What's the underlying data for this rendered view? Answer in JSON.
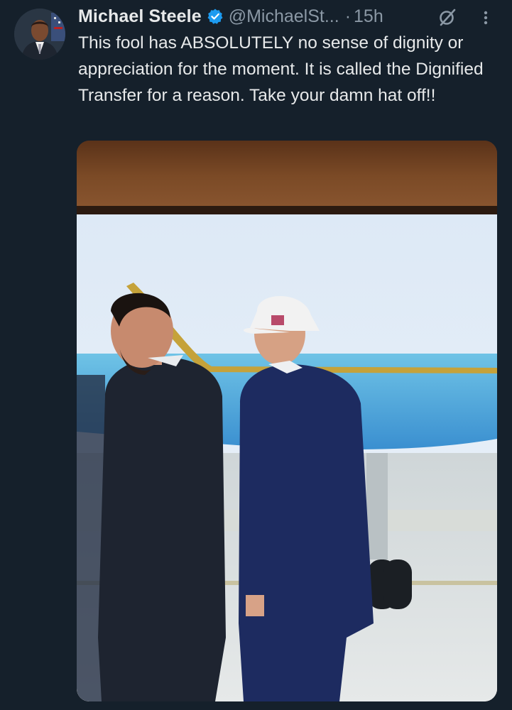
{
  "tweet": {
    "author_name": "Michael Steele",
    "handle": "@MichaelSt...",
    "separator": "·",
    "time": "15h",
    "text": "This fool has ABSOLUTELY no sense of dignity or appreciation for the moment. It is called the Dignified Transfer for a reason. Take your damn hat off!!"
  },
  "icons": {
    "verified": "verified-badge-icon",
    "grok": "grok-icon",
    "more": "more-options-icon"
  },
  "colors": {
    "background": "#15202b",
    "primary_text": "#e7e9ea",
    "secondary_text": "#8b98a5",
    "verified": "#1d9bf0"
  }
}
